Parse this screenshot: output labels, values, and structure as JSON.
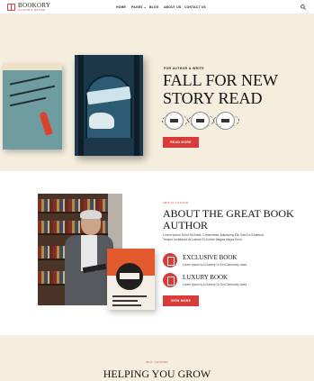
{
  "brand": {
    "name": "BOOKORY",
    "tagline": "AUTHOR & WRITER",
    "accent": "#d93b3b",
    "cream": "#f5eedf"
  },
  "nav": {
    "items": [
      "HOME",
      "PAGES ⌄",
      "BLOG",
      "ABOUT US",
      "CONTACT US"
    ],
    "search_icon": "search-icon"
  },
  "hero": {
    "subtitle": "FOR AUTHOR & WRITE",
    "title": "FALL FOR NEW STORY READ",
    "awards": [
      "award-badge-1",
      "award-badge-2",
      "award-badge-3"
    ],
    "button": "READ MORE"
  },
  "about": {
    "subtitle": "ABOUT AUTHOR",
    "title": "ABOUT THE GREAT BOOK AUTHOR",
    "description": "Lorem Ipsum Dolor Sit Amet, Consectetur Adipiscing Elit, Sed Do Eiusmod Tempor Incididunt Ut Labore Et Dolore Magna Aliqua Enim,",
    "features": [
      {
        "icon": "book-icon",
        "title": "EXCLUSIVE BOOK",
        "desc": "Lorem Ipsum Is A Dummy Or Sot Commonly Used"
      },
      {
        "icon": "book-icon",
        "title": "LUXURY BOOK",
        "desc": "Lorem Ipsum Is A Dummy Or Sot Commonly Used"
      }
    ],
    "button": "VIEW MORE"
  },
  "help": {
    "subtitle": "WHY CHOOSE",
    "title": "HELPING YOU GROW"
  }
}
